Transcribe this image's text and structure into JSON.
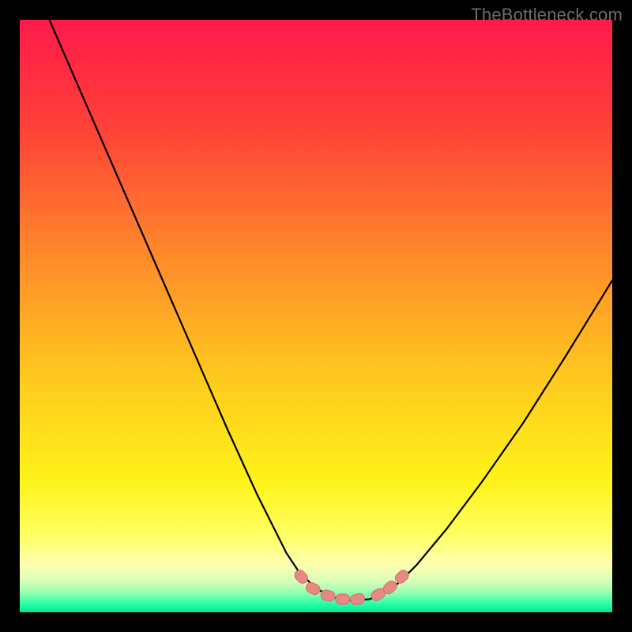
{
  "watermark": "TheBottleneck.com",
  "colors": {
    "frame": "#000000",
    "curve": "#000000",
    "marker_fill": "#e88883",
    "marker_stroke": "#d96e69",
    "gradient_stops": [
      {
        "offset": 0.0,
        "color": "#ff1a4b"
      },
      {
        "offset": 0.18,
        "color": "#ff4037"
      },
      {
        "offset": 0.4,
        "color": "#ff8a2a"
      },
      {
        "offset": 0.6,
        "color": "#ffc81e"
      },
      {
        "offset": 0.78,
        "color": "#fff31a"
      },
      {
        "offset": 0.873,
        "color": "#ffff66"
      },
      {
        "offset": 0.918,
        "color": "#ffffb0"
      },
      {
        "offset": 0.948,
        "color": "#d8ffb8"
      },
      {
        "offset": 0.968,
        "color": "#8fffb0"
      },
      {
        "offset": 0.985,
        "color": "#2dffa8"
      },
      {
        "offset": 1.0,
        "color": "#00e890"
      }
    ]
  },
  "chart_data": {
    "type": "line",
    "title": "",
    "xlabel": "",
    "ylabel": "",
    "xlim": [
      0,
      100
    ],
    "ylim": [
      0,
      100
    ],
    "grid": false,
    "legend": false,
    "series": [
      {
        "name": "bottleneck-curve",
        "x": [
          5,
          10,
          15,
          20,
          25,
          30,
          35,
          40,
          45,
          47,
          50,
          53,
          55,
          57,
          59,
          61,
          64,
          67,
          72,
          78,
          85,
          92,
          100
        ],
        "y": [
          100,
          88.5,
          77,
          65.5,
          54,
          42.5,
          31,
          20,
          10,
          7,
          4,
          2.5,
          2,
          2,
          2.2,
          3,
          5,
          8,
          14,
          22,
          32,
          43,
          56
        ]
      }
    ],
    "markers": {
      "name": "highlight-points",
      "x": [
        47.5,
        49.5,
        52.0,
        54.5,
        57.0,
        60.5,
        62.5,
        64.5
      ],
      "y": [
        6.0,
        4,
        2.8,
        2.2,
        2.2,
        3.0,
        4.2,
        6.0
      ]
    }
  }
}
